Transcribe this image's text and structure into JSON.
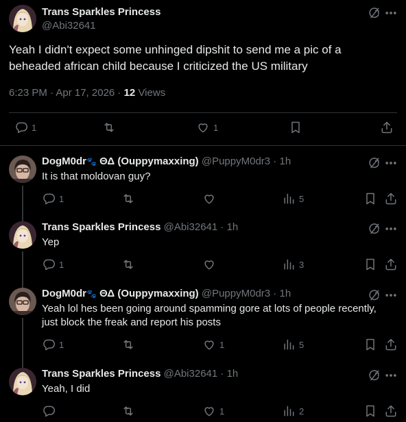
{
  "main_tweet": {
    "author_name": "Trans Sparkles Princess",
    "handle": "@Abi32641",
    "text": "Yeah I didn't expect some unhinged dipshit to send me a pic of a beheaded african child because I criticized the US military",
    "timestamp": "6:23 PM · Apr 17, 2026 · ",
    "views_count": "12",
    "views_label": " Views",
    "replies": "1",
    "reposts": "",
    "likes": "1"
  },
  "replies": [
    {
      "author_name": "DogM0dr",
      "author_badge": "🐾",
      "author_suffix": " ΘΔ (Ouppymaxxing)",
      "handle": "@PuppyM0dr3",
      "time": " · 1h",
      "text": "It is that moldovan guy?",
      "replies": "1",
      "reposts": "",
      "likes": "",
      "views": "5"
    },
    {
      "author_name": "Trans Sparkles Princess",
      "author_badge": "",
      "author_suffix": "",
      "handle": "@Abi32641",
      "time": " · 1h",
      "text": "Yep",
      "replies": "1",
      "reposts": "",
      "likes": "",
      "views": "3"
    },
    {
      "author_name": "DogM0dr",
      "author_badge": "🐾",
      "author_suffix": " ΘΔ (Ouppymaxxing)",
      "handle": "@PuppyM0dr3",
      "time": " · 1h",
      "text": "Yeah lol hes been going around spamming gore at lots of people recently, just block the freak and report his posts",
      "replies": "1",
      "reposts": "",
      "likes": "1",
      "views": "5"
    },
    {
      "author_name": "Trans Sparkles Princess",
      "author_badge": "",
      "author_suffix": "",
      "handle": "@Abi32641",
      "time": " · 1h",
      "text": "Yeah, I did",
      "replies": "",
      "reposts": "",
      "likes": "1",
      "views": "2"
    }
  ],
  "icons": {
    "reply": "reply-icon",
    "repost": "repost-icon",
    "like": "like-icon",
    "views": "views-icon",
    "bookmark": "bookmark-icon",
    "share": "share-icon",
    "grok": "grok-icon",
    "more": "more-icon"
  },
  "colors": {
    "background": "#000000",
    "text": "#e7e9ea",
    "muted": "#71767b",
    "border": "#2f3336"
  }
}
